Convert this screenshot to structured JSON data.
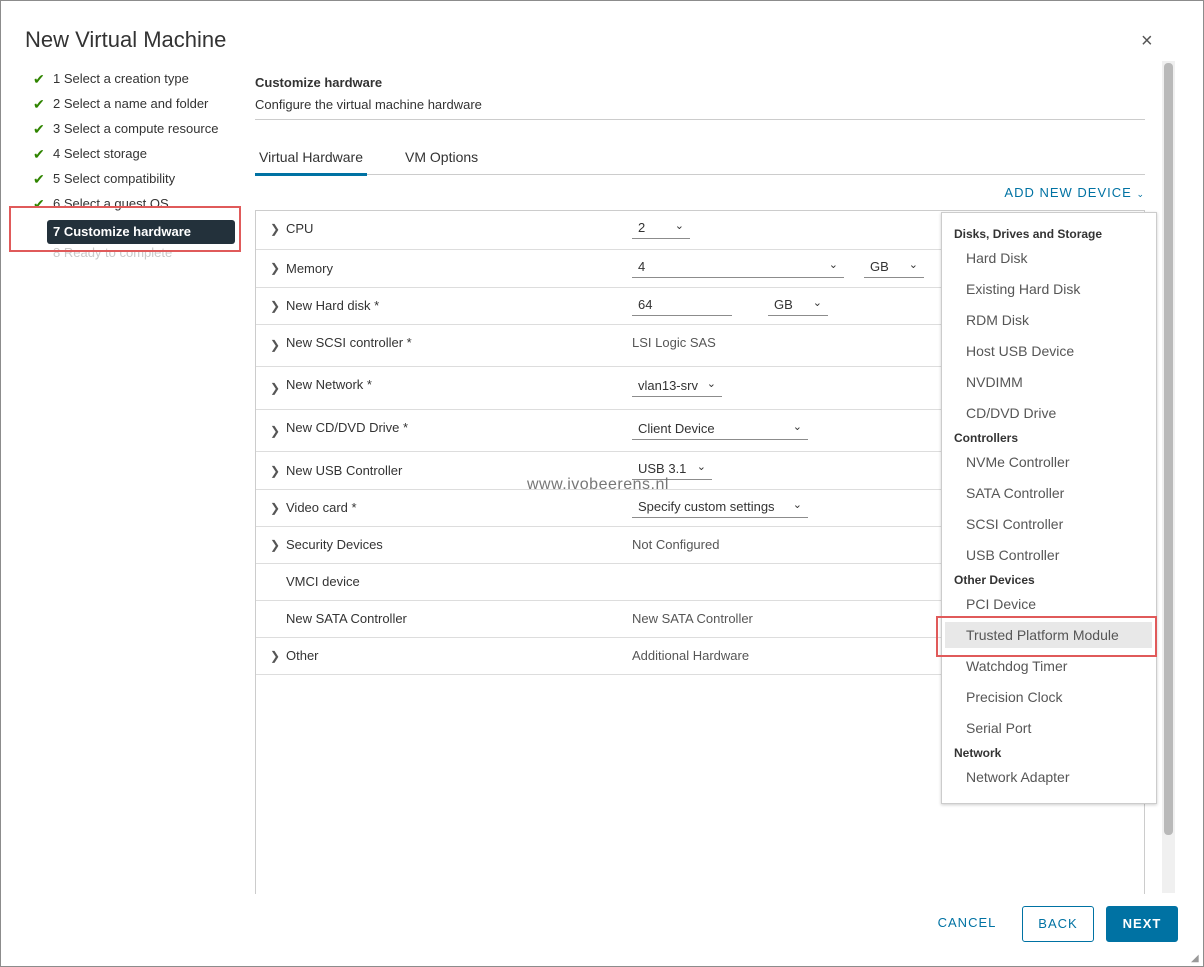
{
  "dialog": {
    "title": "New Virtual Machine",
    "close_symbol": "×"
  },
  "steps": [
    {
      "label": "1 Select a creation type",
      "state": "done"
    },
    {
      "label": "2 Select a name and folder",
      "state": "done"
    },
    {
      "label": "3 Select a compute resource",
      "state": "done"
    },
    {
      "label": "4 Select storage",
      "state": "done"
    },
    {
      "label": "5 Select compatibility",
      "state": "done"
    },
    {
      "label": "6 Select a guest OS",
      "state": "done"
    },
    {
      "label": "7 Customize hardware",
      "state": "active"
    },
    {
      "label": "8 Ready to complete",
      "state": "disabled"
    }
  ],
  "section": {
    "title": "Customize hardware",
    "subtitle": "Configure the virtual machine hardware"
  },
  "tabs": [
    {
      "label": "Virtual Hardware",
      "active": true
    },
    {
      "label": "VM Options",
      "active": false
    }
  ],
  "add_device_label": "ADD NEW DEVICE",
  "hardware": {
    "cpu": {
      "label": "CPU",
      "value": "2"
    },
    "memory": {
      "label": "Memory",
      "value": "4",
      "unit": "GB"
    },
    "hard_disk": {
      "label": "New Hard disk *",
      "value": "64",
      "unit": "GB"
    },
    "scsi": {
      "label": "New SCSI controller *",
      "value": "LSI Logic SAS"
    },
    "network": {
      "label": "New Network *",
      "value": "vlan13-srv"
    },
    "cddvd": {
      "label": "New CD/DVD Drive *",
      "value": "Client Device"
    },
    "usb": {
      "label": "New USB Controller",
      "value": "USB 3.1"
    },
    "video": {
      "label": "Video card *",
      "value": "Specify custom settings"
    },
    "security": {
      "label": "Security Devices",
      "value": "Not Configured"
    },
    "vmci": {
      "label": "VMCI device",
      "value": ""
    },
    "sata": {
      "label": "New SATA Controller",
      "value": "New SATA Controller"
    },
    "other": {
      "label": "Other",
      "value": "Additional Hardware"
    }
  },
  "watermark": "www.ivobeerens.nl",
  "dropdown": {
    "groups": [
      {
        "heading": "Disks, Drives and Storage",
        "items": [
          "Hard Disk",
          "Existing Hard Disk",
          "RDM Disk",
          "Host USB Device",
          "NVDIMM",
          "CD/DVD Drive"
        ]
      },
      {
        "heading": "Controllers",
        "items": [
          "NVMe Controller",
          "SATA Controller",
          "SCSI Controller",
          "USB Controller"
        ]
      },
      {
        "heading": "Other Devices",
        "items": [
          "PCI Device",
          "Trusted Platform Module",
          "Watchdog Timer",
          "Precision Clock",
          "Serial Port"
        ]
      },
      {
        "heading": "Network",
        "items": [
          "Network Adapter"
        ]
      }
    ],
    "highlighted": "Trusted Platform Module"
  },
  "footer": {
    "cancel": "CANCEL",
    "back": "BACK",
    "next": "NEXT"
  },
  "colors": {
    "accent": "#0072a3",
    "active_step_bg": "#23313b",
    "check": "#2f8400",
    "annotation": "#e05a5a"
  }
}
